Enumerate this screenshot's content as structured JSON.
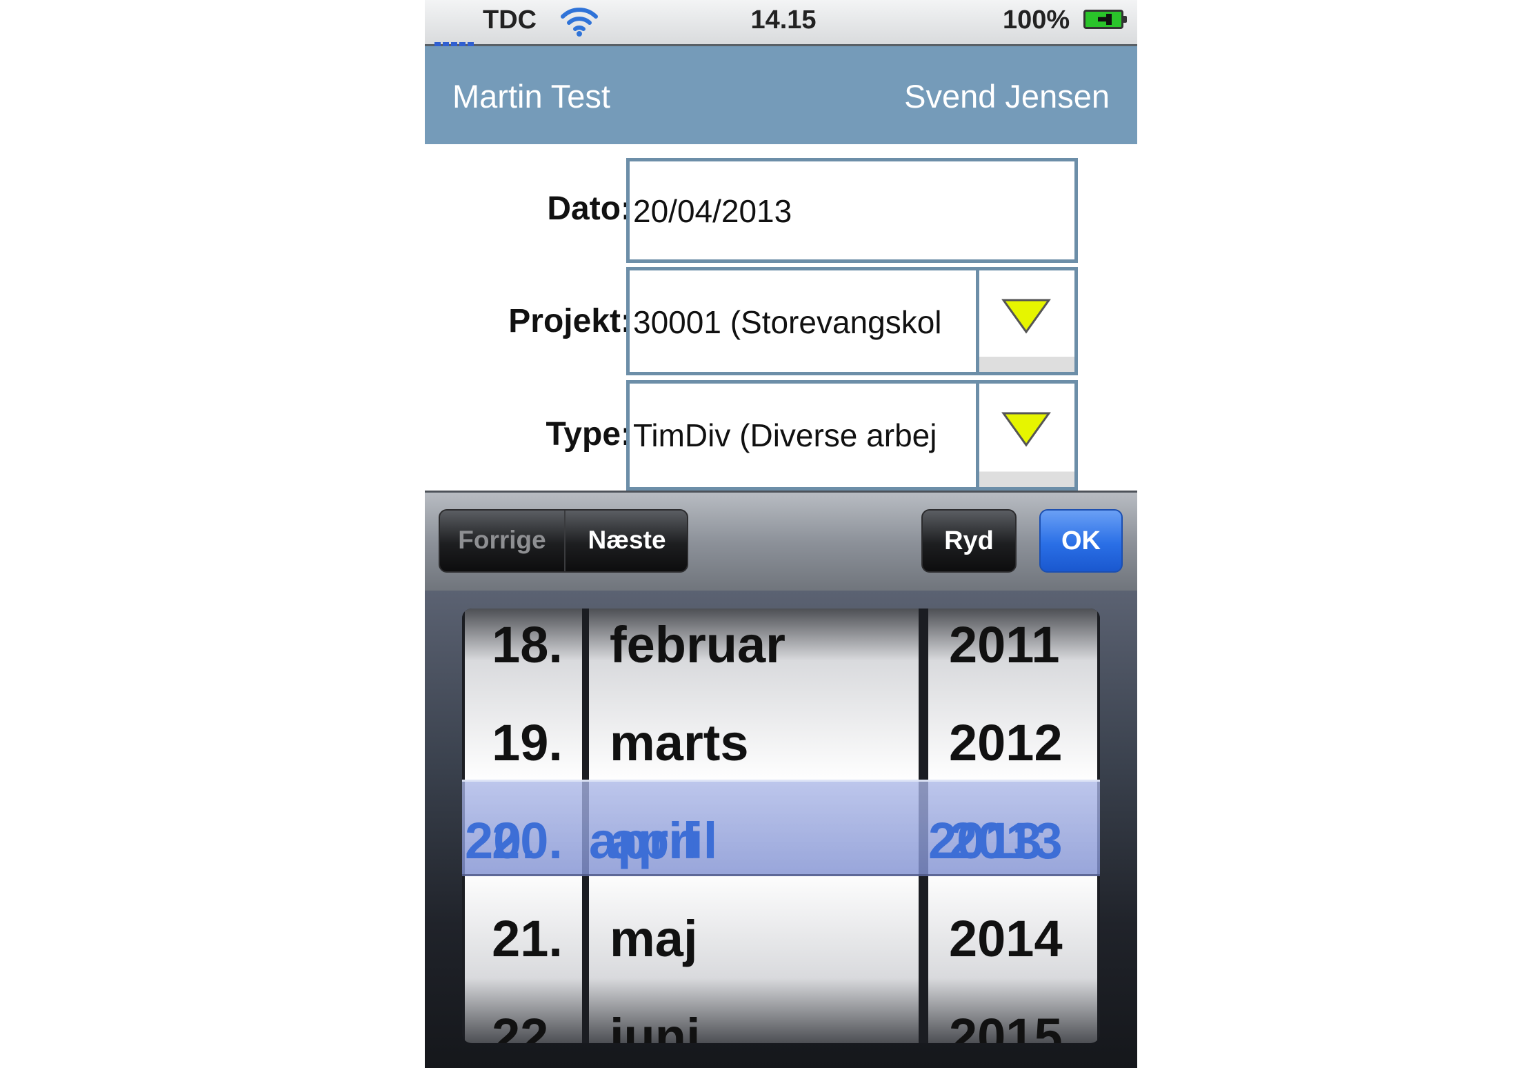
{
  "status_bar": {
    "carrier": "TDC",
    "time": "14.15",
    "battery": "100%",
    "icons": [
      "signal-icon",
      "wifi-icon",
      "battery-charging-icon"
    ]
  },
  "header": {
    "left_name": "Martin Test",
    "right_name": "Svend Jensen"
  },
  "form": {
    "dato_label": "Dato:",
    "dato_value": "20/04/2013",
    "projekt_label": "Projekt:",
    "projekt_value": "30001 (Storevangskol",
    "type_label": "Type:",
    "type_value": "TimDiv (Diverse arbej"
  },
  "toolbar": {
    "prev_label": "Forrige",
    "next_label": "Næste",
    "clear_label": "Ryd",
    "ok_label": "OK"
  },
  "picker": {
    "days": [
      "18.",
      "19.",
      "20.",
      "21.",
      "22."
    ],
    "months": [
      "februar",
      "marts",
      "april",
      "maj",
      "juni"
    ],
    "years": [
      "2011",
      "2012",
      "2013",
      "2014",
      "2015"
    ],
    "selected_index": 2
  },
  "colors": {
    "header_bg": "#759bb9",
    "field_border": "#6c8ea8",
    "dropdown_arrow": "#e6f500",
    "ok_button": "#2a6fe6",
    "picker_selected_text": "#3d6ed6"
  }
}
